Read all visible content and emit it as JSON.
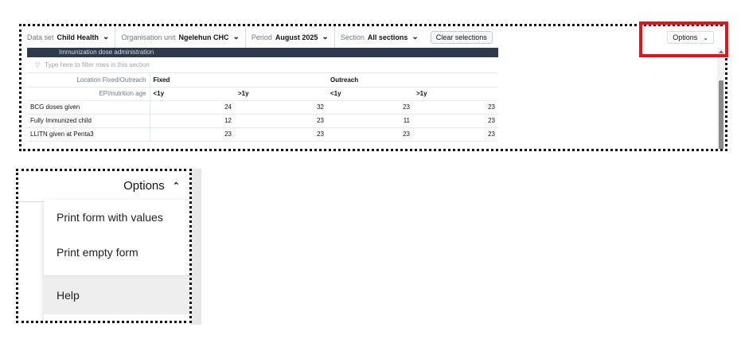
{
  "toolbar": {
    "dataset": {
      "label": "Data set",
      "value": "Child Health"
    },
    "org_unit": {
      "label": "Organisation unit",
      "value": "Ngelehun CHC"
    },
    "period": {
      "label": "Period",
      "value": "August 2025"
    },
    "section": {
      "label": "Section",
      "value": "All sections"
    },
    "clear_label": "Clear selections",
    "options_label": "Options"
  },
  "section": {
    "title": "Immunization dose administration",
    "filter_placeholder": "Type here to filter rows in this section",
    "location_label": "Location Fixed/Outreach",
    "location_fixed": "Fixed",
    "location_outreach": "Outreach",
    "age_label": "EPI/nutrition age",
    "age_cols": [
      "<1y",
      ">1y",
      "<1y",
      ">1y"
    ],
    "rows": [
      {
        "name": "BCG doses given",
        "values": [
          "24",
          "32",
          "23",
          "23"
        ]
      },
      {
        "name": "Fully Immunized child",
        "values": [
          "12",
          "23",
          "11",
          "23"
        ]
      },
      {
        "name": "LLITN given at Penta3",
        "values": [
          "23",
          "23",
          "23",
          "23"
        ]
      }
    ]
  },
  "options_menu": {
    "button_label": "Options",
    "items": [
      "Print form with values",
      "Print empty form",
      "Help"
    ]
  },
  "icons": {
    "chevron": "chevron-down-icon",
    "chevron_up": "chevron-up-icon",
    "filter": "filter-icon"
  },
  "colors": {
    "highlight": "#e0141b",
    "section_header": "#2e3a4b"
  }
}
